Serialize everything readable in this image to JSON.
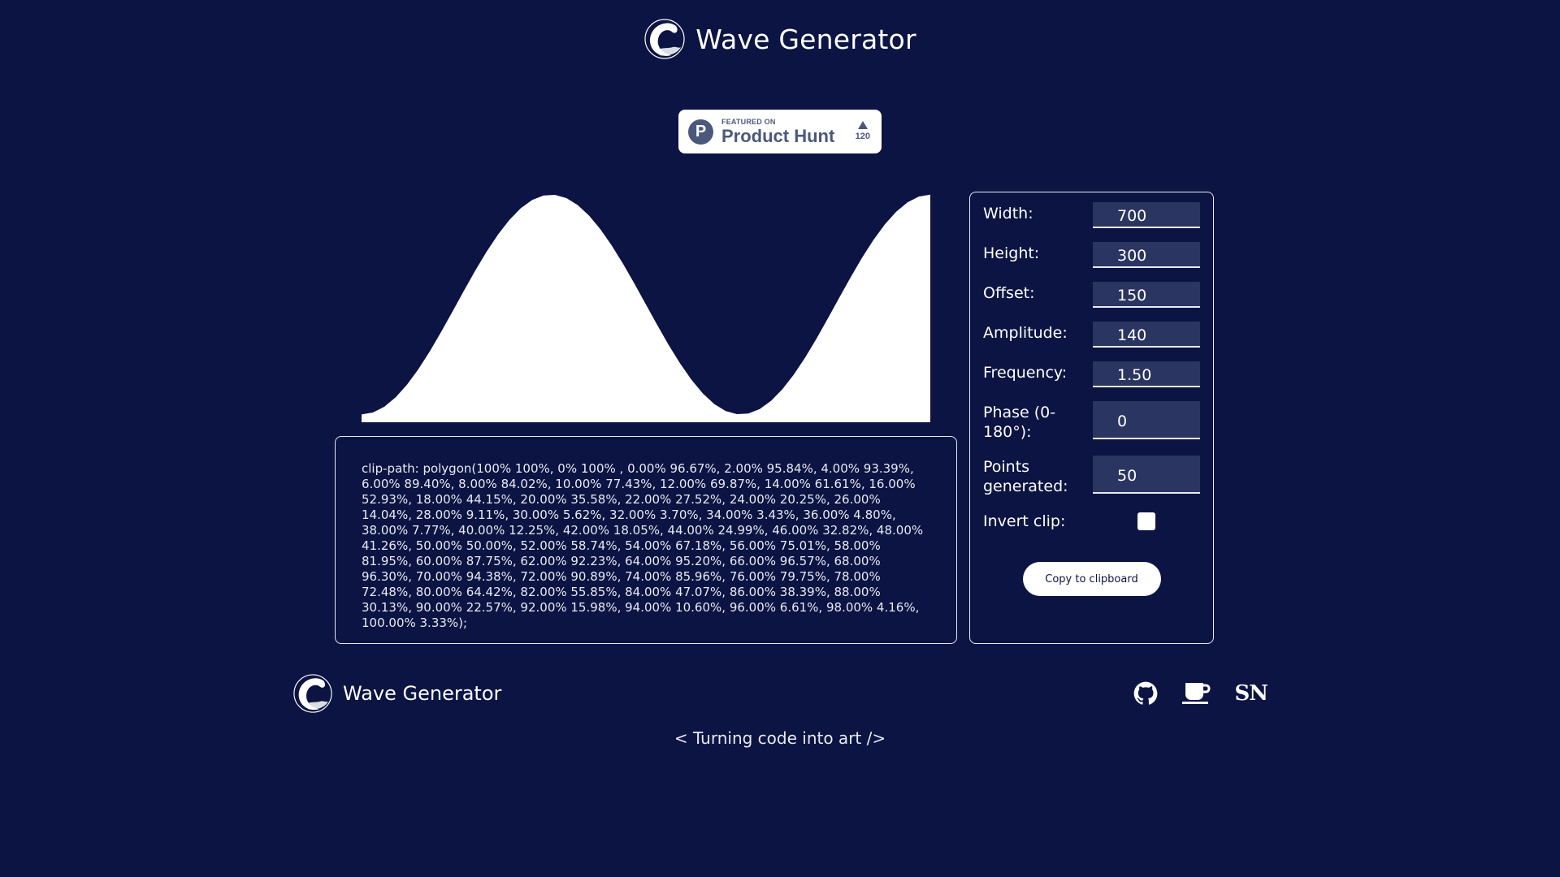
{
  "header": {
    "title": "Wave Generator",
    "logo_icon": "wave-logo-icon"
  },
  "product_hunt": {
    "featured_label": "FEATURED ON",
    "name": "Product Hunt",
    "votes": "120",
    "icon": "product-hunt-icon"
  },
  "wave_preview": {
    "points": [
      [
        0.0,
        96.67
      ],
      [
        2.0,
        95.84
      ],
      [
        4.0,
        93.39
      ],
      [
        6.0,
        89.4
      ],
      [
        8.0,
        84.02
      ],
      [
        10.0,
        77.43
      ],
      [
        12.0,
        69.87
      ],
      [
        14.0,
        61.61
      ],
      [
        16.0,
        52.93
      ],
      [
        18.0,
        44.15
      ],
      [
        20.0,
        35.58
      ],
      [
        22.0,
        27.52
      ],
      [
        24.0,
        20.25
      ],
      [
        26.0,
        14.04
      ],
      [
        28.0,
        9.11
      ],
      [
        30.0,
        5.62
      ],
      [
        32.0,
        3.7
      ],
      [
        34.0,
        3.43
      ],
      [
        36.0,
        4.8
      ],
      [
        38.0,
        7.77
      ],
      [
        40.0,
        12.25
      ],
      [
        42.0,
        18.05
      ],
      [
        44.0,
        24.99
      ],
      [
        46.0,
        32.82
      ],
      [
        48.0,
        41.26
      ],
      [
        50.0,
        50.0
      ],
      [
        52.0,
        58.74
      ],
      [
        54.0,
        67.18
      ],
      [
        56.0,
        75.01
      ],
      [
        58.0,
        81.95
      ],
      [
        60.0,
        87.75
      ],
      [
        62.0,
        92.23
      ],
      [
        64.0,
        95.2
      ],
      [
        66.0,
        96.57
      ],
      [
        68.0,
        96.3
      ],
      [
        70.0,
        94.38
      ],
      [
        72.0,
        90.89
      ],
      [
        74.0,
        85.96
      ],
      [
        76.0,
        79.75
      ],
      [
        78.0,
        72.48
      ],
      [
        80.0,
        64.42
      ],
      [
        82.0,
        55.85
      ],
      [
        84.0,
        47.07
      ],
      [
        86.0,
        38.39
      ],
      [
        88.0,
        30.13
      ],
      [
        90.0,
        22.57
      ],
      [
        92.0,
        15.98
      ],
      [
        94.0,
        10.6
      ],
      [
        96.0,
        6.61
      ],
      [
        98.0,
        4.16
      ],
      [
        100.0,
        3.33
      ]
    ],
    "fill_color": "#ffffff"
  },
  "code_output": "clip-path: polygon(100% 100%, 0% 100% , 0.00% 96.67%, 2.00% 95.84%, 4.00% 93.39%, 6.00% 89.40%, 8.00% 84.02%, 10.00% 77.43%, 12.00% 69.87%, 14.00% 61.61%, 16.00% 52.93%, 18.00% 44.15%, 20.00% 35.58%, 22.00% 27.52%, 24.00% 20.25%, 26.00% 14.04%, 28.00% 9.11%, 30.00% 5.62%, 32.00% 3.70%, 34.00% 3.43%, 36.00% 4.80%, 38.00% 7.77%, 40.00% 12.25%, 42.00% 18.05%, 44.00% 24.99%, 46.00% 32.82%, 48.00% 41.26%, 50.00% 50.00%, 52.00% 58.74%, 54.00% 67.18%, 56.00% 75.01%, 58.00% 81.95%, 60.00% 87.75%, 62.00% 92.23%, 64.00% 95.20%, 66.00% 96.57%, 68.00% 96.30%, 70.00% 94.38%, 72.00% 90.89%, 74.00% 85.96%, 76.00% 79.75%, 78.00% 72.48%, 80.00% 64.42%, 82.00% 55.85%, 84.00% 47.07%, 86.00% 38.39%, 88.00% 30.13%, 90.00% 22.57%, 92.00% 15.98%, 94.00% 10.60%, 96.00% 6.61%, 98.00% 4.16%, 100.00% 3.33%);",
  "controls": {
    "width": {
      "label": "Width:",
      "value": "700"
    },
    "height": {
      "label": "Height:",
      "value": "300"
    },
    "offset": {
      "label": "Offset:",
      "value": "150"
    },
    "amplitude": {
      "label": "Amplitude:",
      "value": "140"
    },
    "frequency": {
      "label": "Frequency:",
      "value": "1.50"
    },
    "phase": {
      "label": "Phase (0-180°):",
      "value": "0"
    },
    "points": {
      "label": "Points generated:",
      "value": "50"
    },
    "invert": {
      "label": "Invert clip:",
      "checked": false
    },
    "copy_label": "Copy to clipboard"
  },
  "footer": {
    "title": "Wave Generator",
    "icons": [
      "github-icon",
      "coffee-icon",
      "sn-logo-icon"
    ],
    "sn_text": "SN",
    "tagline": "< Turning code into art />"
  },
  "colors": {
    "background": "#0b1442",
    "input_bg": "#2b3561",
    "ph_accent": "#4b587c"
  }
}
